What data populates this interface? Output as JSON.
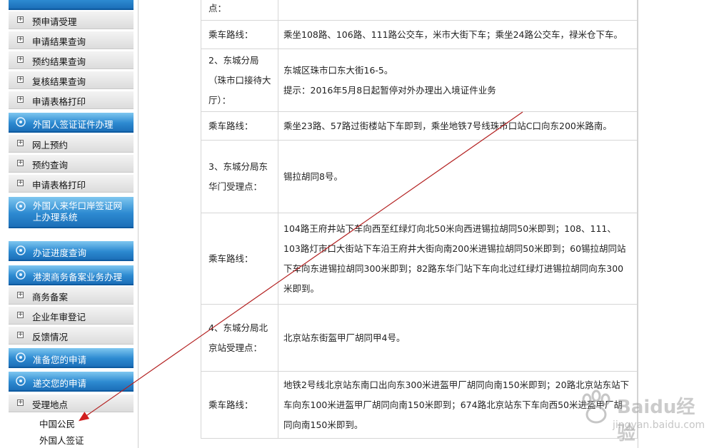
{
  "sidebar": {
    "items": [
      {
        "type": "sub",
        "label": "预申请受理"
      },
      {
        "type": "sub",
        "label": "申请结果查询"
      },
      {
        "type": "sub",
        "label": "预约结果查询"
      },
      {
        "type": "sub",
        "label": "复核结果查询"
      },
      {
        "type": "sub",
        "label": "申请表格打印"
      },
      {
        "type": "cat",
        "label": "外国人签证证件办理"
      },
      {
        "type": "sub",
        "label": "网上预约"
      },
      {
        "type": "sub",
        "label": "预约查询"
      },
      {
        "type": "sub",
        "label": "申请表格打印"
      },
      {
        "type": "cat",
        "label": "外国人来华口岸签证网上办理系统"
      },
      {
        "type": "cat",
        "label": "办证进度查询"
      },
      {
        "type": "cat",
        "label": "港澳商务备案业务办理"
      },
      {
        "type": "sub",
        "label": "商务备案"
      },
      {
        "type": "sub",
        "label": "企业年审登记"
      },
      {
        "type": "sub",
        "label": "反馈情况"
      },
      {
        "type": "cat",
        "label": "准备您的申请"
      },
      {
        "type": "cat",
        "label": "递交您的申请"
      },
      {
        "type": "sub",
        "label": "受理地点"
      },
      {
        "type": "leaf",
        "label": "中国公民"
      },
      {
        "type": "leaf",
        "label": "外国人签证"
      }
    ]
  },
  "content": {
    "rows": [
      {
        "key": "点：",
        "value": ""
      },
      {
        "key": "乘车路线：",
        "value": "乘坐108路、106路、111路公交车，米市大街下车；乘坐24路公交车，禄米仓下车。"
      },
      {
        "key": "2、东城分局（珠市口接待大厅）：",
        "value": "东城区珠市口东大街16-5。",
        "note": "提示：2016年5月8日起暂停对外办理出入境证件业务"
      },
      {
        "key": "乘车路线：",
        "value": "乘坐23路、57路过街楼站下车即到，乘坐地铁7号线珠市口站C口向东200米路南。"
      },
      {
        "key": "3、东城分局东华门受理点：",
        "value": "锡拉胡同8号。"
      },
      {
        "key": "乘车路线：",
        "value": "104路王府井站下车向西至红绿灯向北50米向西进锡拉胡同50米即到；108、111、103路灯市口大街站下车沿王府井大街向南200米进锡拉胡同50米即到；60锡拉胡同站下车向东进锡拉胡同300米即到；82路东华门站下车向北过红绿灯进锡拉胡同向东300米即到。"
      },
      {
        "key": "4、东城分局北京站受理点：",
        "value": "北京站东街盔甲厂胡同甲4号。"
      },
      {
        "key": "乘车路线：",
        "value": "地铁2号线北京站东南口出向东300米进盔甲厂胡同向南150米即到；20路北京站东站下车向东100米进盔甲厂胡同向南150米即到；674路北京站东下车向西50米进盔甲厂胡同向南150米即到。"
      }
    ]
  },
  "watermark": {
    "logo": "Baidu经验",
    "url": "jingyan.baidu.com"
  },
  "colors": {
    "category_blue": "#2d8ad1",
    "arrow": "#c0392b",
    "border": "#d6d6d6"
  }
}
